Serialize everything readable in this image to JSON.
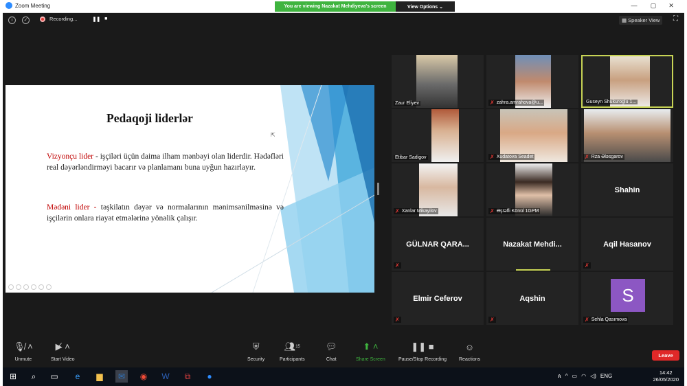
{
  "window": {
    "title": "Zoom Meeting",
    "viewing_banner": "You are viewing Nazakat Mehdiyeva's screen",
    "view_options": "View Options ⌄"
  },
  "topbar": {
    "recording_label": "Recording...",
    "speaker_view": "Speaker View"
  },
  "slide": {
    "title": "Pedaqoji liderlər",
    "p1_term": "Vizyonçu lider",
    "p1_text": " - işçiləri üçün daima ilham mənbəyi olan liderdir. Hədəfləri real dəyərləndirməyi bacarır və planlamanı buna uyğun hazırlayır.",
    "p2_term": "Mədəni lider -",
    "p2_text": " təşkilatın dəyər və normalarının mənimsənilməsinə və işçilərin onlara riayət etmələrinə yönəlik çalışır."
  },
  "participants": [
    {
      "name": "Zaur Eliyev",
      "muted": false
    },
    {
      "name": "zahra.amrahova@u...",
      "muted": true
    },
    {
      "name": "Guseyn Shukuroglu 1...",
      "muted": false
    },
    {
      "name": "Etibar Sadigov",
      "muted": false
    },
    {
      "name": "Xudatova Seadet",
      "muted": true
    },
    {
      "name": "Rza Ələsgarov",
      "muted": true
    },
    {
      "name": "Xanlar Mikayilov",
      "muted": true
    },
    {
      "name": "Əşrəfli Könül 1GPM",
      "muted": true
    },
    {
      "name": "Shahin",
      "muted": false
    },
    {
      "name": "GÜLNAR QARA...",
      "muted": true
    },
    {
      "name": "Nazakat Mehdi...",
      "muted": true
    },
    {
      "name": "Aqil Hasanov",
      "muted": true
    },
    {
      "name": "Elmir Ceferov",
      "muted": true
    },
    {
      "name": "Aqshin",
      "muted": true
    },
    {
      "name": "Sehla Qasımova",
      "muted": true,
      "avatar": "S"
    }
  ],
  "toolbar": {
    "unmute": "Unmute",
    "start_video": "Start Video",
    "security": "Security",
    "participants": "Participants",
    "participants_count": "15",
    "chat": "Chat",
    "share_screen": "Share Screen",
    "pause_recording": "Pause/Stop Recording",
    "reactions": "Reactions",
    "leave": "Leave"
  },
  "taskbar": {
    "time": "14:42",
    "date": "26/05/2020",
    "lang": "ENG"
  },
  "colors": {
    "share_green": "#3fb43f",
    "leave_red": "#e02828",
    "avatar_purple": "#8c57c3",
    "active_border": "#c8d455"
  }
}
